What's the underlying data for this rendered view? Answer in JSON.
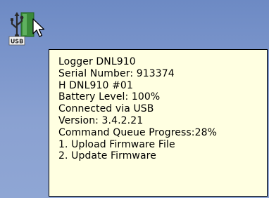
{
  "tray_icon": {
    "name": "usb-logger-icon",
    "badge_text": "USB"
  },
  "tooltip": {
    "lines": [
      "Logger DNL910",
      "Serial Number: 913374",
      "H DNL910 #01",
      "Battery Level: 100%",
      "Connected via USB",
      "Version: 3.4.2.21",
      "Command Queue Progress:28%",
      "1. Upload Firmware File",
      "2. Update Firmware"
    ],
    "background": "#ffffe1",
    "border": "#000000"
  },
  "colors": {
    "desktop": "#7b95cb"
  }
}
